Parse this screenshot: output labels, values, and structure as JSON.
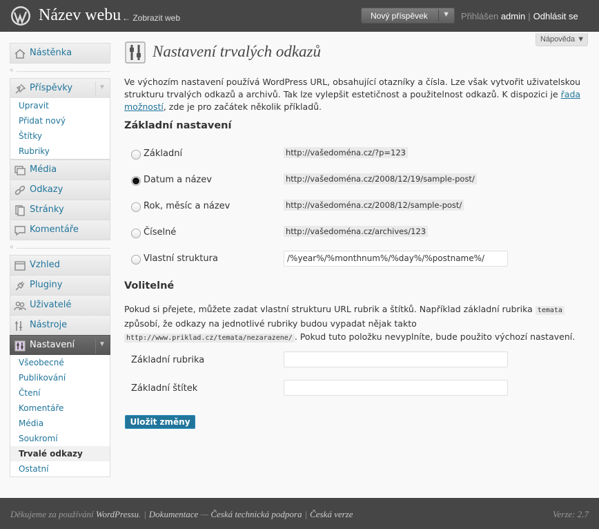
{
  "header": {
    "site_title": "Název webu",
    "view_site": "← Zobrazit web",
    "new_post": "Nový příspěvek",
    "logged_in_prefix": "Přihlášen",
    "username": "admin",
    "logout": "Odhlásit se"
  },
  "help_tab": "Nápověda ▼",
  "sidebar": {
    "dashboard": "Nástěnka",
    "posts": "Příspěvky",
    "posts_sub": [
      "Upravit",
      "Přidat nový",
      "Štítky",
      "Rubriky"
    ],
    "media": "Média",
    "links": "Odkazy",
    "pages": "Stránky",
    "comments": "Komentáře",
    "appearance": "Vzhled",
    "plugins": "Pluginy",
    "users": "Uživatelé",
    "tools": "Nástroje",
    "settings": "Nastavení",
    "settings_sub": [
      "Všeobecné",
      "Publikování",
      "Čtení",
      "Komentáře",
      "Média",
      "Soukromí",
      "Trvalé odkazy",
      "Ostatní"
    ]
  },
  "main": {
    "title": "Nastavení trvalých odkazů",
    "intro_1": "Ve výchozím nastavení používá WordPress URL, obsahující otazníky a čísla. Lze však vytvořit uživatelskou strukturu trvalých odkazů a archivů. Tak lze vylepšit estetičnost a použitelnost odkazů. K dispozici je ",
    "intro_link": "řada možností",
    "intro_2": ", zde je pro začátek několik příkladů.",
    "common_heading": "Základní nastavení",
    "options": [
      {
        "label": "Základní",
        "example": "http://vašedoména.cz/?p=123",
        "checked": false
      },
      {
        "label": "Datum a název",
        "example": "http://vašedoména.cz/2008/12/19/sample-post/",
        "checked": true
      },
      {
        "label": "Rok, měsíc a název",
        "example": "http://vašedoména.cz/2008/12/sample-post/",
        "checked": false
      },
      {
        "label": "Číselné",
        "example": "http://vašedoména.cz/archives/123",
        "checked": false
      },
      {
        "label": "Vlastní struktura",
        "value": "/%year%/%monthnum%/%day%/%postname%/",
        "checked": false
      }
    ],
    "optional_heading": "Volitelné",
    "optional_desc_1": "Pokud si přejete, můžete zadat vlastní strukturu URL rubrik a štítků. Například základní rubrika ",
    "optional_code_1": "temata",
    "optional_desc_2": " způsobí, že odkazy na jednotlivé rubriky budou vypadat nějak takto ",
    "optional_code_2": "http://www.priklad.cz/temata/nezarazene/",
    "optional_desc_3": ". Pokud tuto položku nevyplníte, bude použito výchozí nastavení.",
    "category_base_label": "Základní rubrika",
    "category_base_value": "",
    "tag_base_label": "Základní štítek",
    "tag_base_value": "",
    "save_button": "Uložit změny"
  },
  "footer": {
    "thanks_prefix": "Děkujeme za používání ",
    "wordpress": "WordPressu",
    "thanks_suffix": ".",
    "docs": "Dokumentace",
    "dash": " — ",
    "czech_support": "Česká technická podpora",
    "czech_version": "Česká verze",
    "version": "Verze: 2.7"
  },
  "colors": {
    "accent": "#21759b",
    "header_bg": "#464646",
    "page_bg": "#f9f9f9"
  }
}
